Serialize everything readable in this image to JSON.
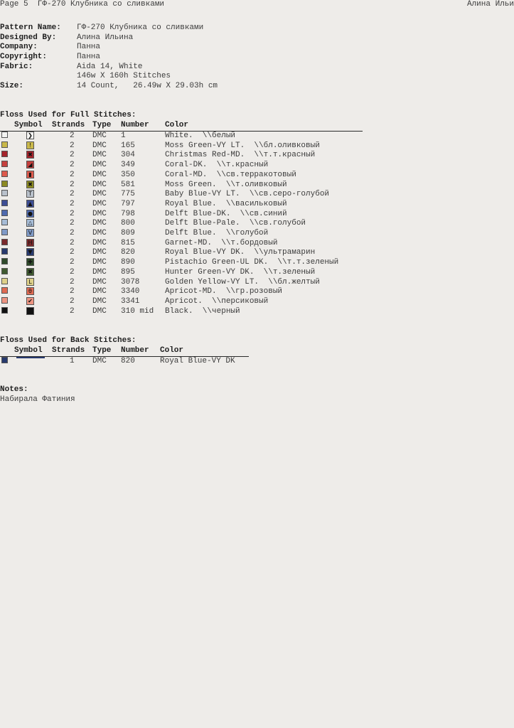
{
  "header": {
    "page_label": "Page 5  ГФ-270 Клубника со сливками",
    "author_short": "Алина Ильи"
  },
  "info": [
    {
      "key": "Pattern Name:",
      "value": "ГФ-270 Клубника со сливками"
    },
    {
      "key": "Designed By:",
      "value": "Алина Ильина"
    },
    {
      "key": "Company:",
      "value": "Панна"
    },
    {
      "key": "Copyright:",
      "value": "Панна"
    },
    {
      "key": "Fabric:",
      "value": "Aida 14, White"
    },
    {
      "key": "",
      "value": "146w X 160h Stitches"
    },
    {
      "key": "Size:",
      "value": "14 Count,   26.49w X 29.03h cm"
    }
  ],
  "full": {
    "title": "Floss Used for Full Stitches:",
    "headers": {
      "symbol": "Symbol",
      "strands": "Strands",
      "type": "Type",
      "number": "Number",
      "color": "Color"
    },
    "rows": [
      {
        "swatch": "#f4f4f2",
        "glyph": "❯",
        "strands": "2",
        "type": "DMC",
        "number": "1",
        "color": "White.  \\\\белый"
      },
      {
        "swatch": "#c9b84a",
        "glyph": "!",
        "strands": "2",
        "type": "DMC",
        "number": "165",
        "color": "Moss Green-VY LT.  \\\\бл.оливковый"
      },
      {
        "swatch": "#a5242b",
        "glyph": "✖",
        "strands": "2",
        "type": "DMC",
        "number": "304",
        "color": "Christmas Red-MD.  \\\\т.т.красный"
      },
      {
        "swatch": "#c5403d",
        "glyph": "◢",
        "strands": "2",
        "type": "DMC",
        "number": "349",
        "color": "Coral-DK.  \\\\т.красный"
      },
      {
        "swatch": "#dd5a4c",
        "glyph": "▮",
        "strands": "2",
        "type": "DMC",
        "number": "350",
        "color": "Coral-MD.  \\\\св.терракотовый"
      },
      {
        "swatch": "#8c8a22",
        "glyph": "✖",
        "strands": "2",
        "type": "DMC",
        "number": "581",
        "color": "Moss Green.  \\\\т.оливковый"
      },
      {
        "swatch": "#b9c1cb",
        "glyph": "T",
        "strands": "2",
        "type": "DMC",
        "number": "775",
        "color": "Baby Blue-VY LT.  \\\\св.серо-голубой"
      },
      {
        "swatch": "#3d4e94",
        "glyph": "▲",
        "strands": "2",
        "type": "DMC",
        "number": "797",
        "color": "Royal Blue.  \\\\васильковый"
      },
      {
        "swatch": "#4f6aae",
        "glyph": "●",
        "strands": "2",
        "type": "DMC",
        "number": "798",
        "color": "Delft Blue-DK.  \\\\св.синий"
      },
      {
        "swatch": "#a6bcd6",
        "glyph": "△",
        "strands": "2",
        "type": "DMC",
        "number": "800",
        "color": "Delft Blue-Pale.  \\\\св.голубой"
      },
      {
        "swatch": "#7f9ac7",
        "glyph": "V",
        "strands": "2",
        "type": "DMC",
        "number": "809",
        "color": "Delft Blue.  \\\\голубой"
      },
      {
        "swatch": "#7a2a2c",
        "glyph": "H",
        "strands": "2",
        "type": "DMC",
        "number": "815",
        "color": "Garnet-MD.  \\\\т.бордовый"
      },
      {
        "swatch": "#283a6e",
        "glyph": "▼",
        "strands": "2",
        "type": "DMC",
        "number": "820",
        "color": "Royal Blue-VY DK.  \\\\ультрамарин"
      },
      {
        "swatch": "#2f4a2a",
        "glyph": "✚",
        "strands": "2",
        "type": "DMC",
        "number": "890",
        "color": "Pistachio Green-UL DK.  \\\\т.т.зеленый"
      },
      {
        "swatch": "#3f5a30",
        "glyph": "✖",
        "strands": "2",
        "type": "DMC",
        "number": "895",
        "color": "Hunter Green-VY DK.  \\\\т.зеленый"
      },
      {
        "swatch": "#ddd089",
        "glyph": "L",
        "strands": "2",
        "type": "DMC",
        "number": "3078",
        "color": "Golden Yellow-VY LT.  \\\\бл.желтый"
      },
      {
        "swatch": "#df6a52",
        "glyph": "θ",
        "strands": "2",
        "type": "DMC",
        "number": "3340",
        "color": "Apricot-MD.  \\\\гр.розовый"
      },
      {
        "swatch": "#ec9380",
        "glyph": "✔",
        "strands": "2",
        "type": "DMC",
        "number": "3341",
        "color": "Apricot.  \\\\персиковый"
      },
      {
        "swatch": "#111111",
        "glyph": "/",
        "strands": "2",
        "type": "DMC",
        "number": "310 mid",
        "color": "Black.  \\\\черный"
      }
    ]
  },
  "back": {
    "title": "Floss Used for Back Stitches:",
    "headers": {
      "symbol": "Symbol",
      "strands": "Strands",
      "type": "Type",
      "number": "Number",
      "color": "Color"
    },
    "rows": [
      {
        "swatch": "#283a6e",
        "strands": "1",
        "type": "DMC",
        "number": "820",
        "color": "Royal Blue-VY DK"
      }
    ]
  },
  "notes": {
    "title": "Notes:",
    "text": "Набирала Фатиния"
  }
}
